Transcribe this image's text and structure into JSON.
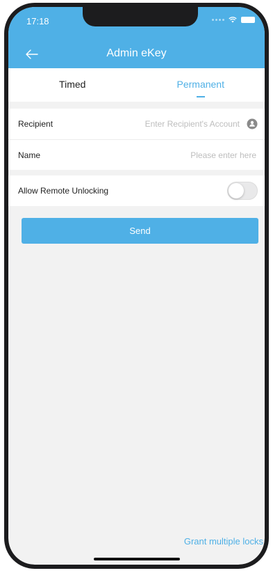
{
  "status_bar": {
    "time": "17:18"
  },
  "header": {
    "title": "Admin eKey",
    "back_icon": "arrow-left-icon"
  },
  "tabs": [
    {
      "label": "Timed",
      "active": false
    },
    {
      "label": "Permanent",
      "active": true
    }
  ],
  "form": {
    "recipient": {
      "label": "Recipient",
      "value": "",
      "placeholder": "Enter Recipient's Account",
      "icon": "contact-icon"
    },
    "name": {
      "label": "Name",
      "value": "",
      "placeholder": "Please enter here"
    },
    "remote_unlock": {
      "label": "Allow Remote Unlocking",
      "enabled": false
    }
  },
  "send_button": {
    "label": "Send"
  },
  "footer": {
    "grant_link": "Grant multiple locks"
  },
  "colors": {
    "accent": "#4fb0e6",
    "background": "#f2f2f2",
    "card": "#ffffff"
  }
}
